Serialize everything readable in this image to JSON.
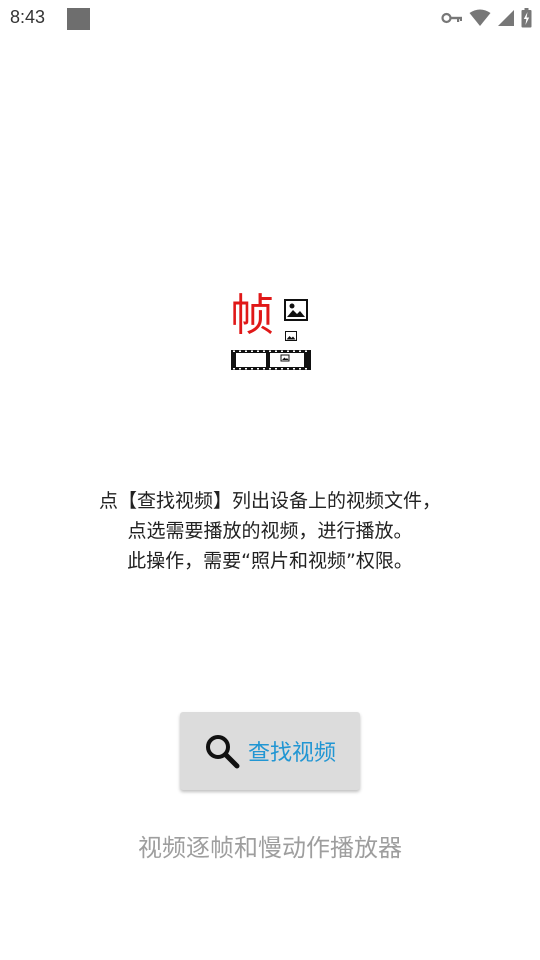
{
  "status_bar": {
    "time": "8:43",
    "icons": [
      "vpn-key-icon",
      "wifi-icon",
      "cell-signal-icon",
      "battery-charging-icon"
    ]
  },
  "logo": {
    "char": "帧"
  },
  "description": {
    "line1": "点【查找视频】列出设备上的视频文件，点选需要播放的视频，进行播放。",
    "line2": "此操作，需要“照片和视频”权限。"
  },
  "find_button": {
    "label": "查找视频",
    "icon": "search-icon"
  },
  "app_subtitle": "视频逐帧和慢动作播放器",
  "colors": {
    "logo_red": "#e01818",
    "button_bg": "#dcdcdc",
    "button_text": "#2196d3",
    "subtitle": "#9e9e9e"
  }
}
